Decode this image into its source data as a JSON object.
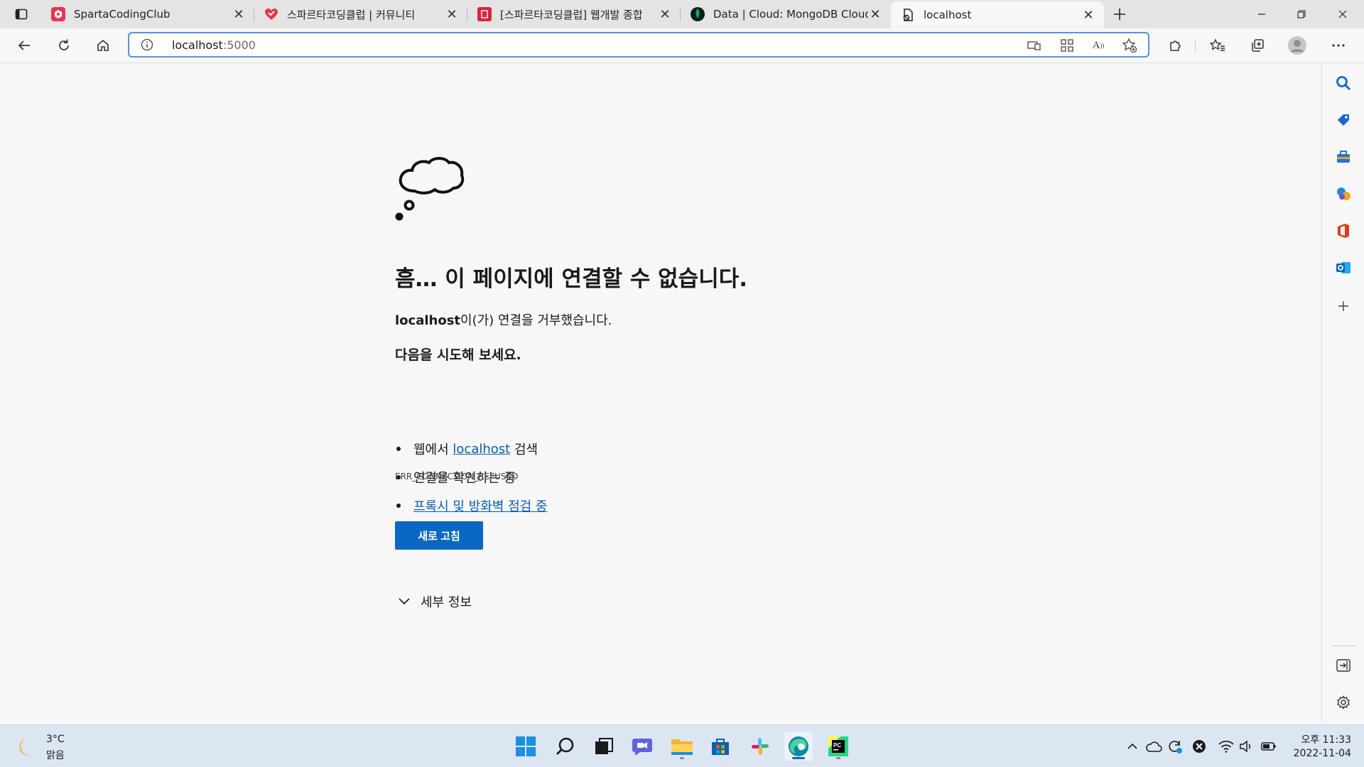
{
  "tabs": [
    {
      "title": "SpartaCodingClub",
      "favicon": "sparta-icon",
      "active": false
    },
    {
      "title": "스파르타코딩클럽 | 커뮤니티",
      "favicon": "heart-icon",
      "active": false
    },
    {
      "title": "[스파르타코딩클럽] 웹개발 종합",
      "favicon": "book-icon",
      "active": false
    },
    {
      "title": "Data | Cloud: MongoDB Cloud",
      "favicon": "mongodb-leaf-icon",
      "active": false
    },
    {
      "title": "localhost",
      "favicon": "broken-page-icon",
      "active": true
    }
  ],
  "address": {
    "host": "localhost",
    "port": ":5000"
  },
  "error": {
    "title": "흠… 이 페이지에 연결할 수 없습니다.",
    "host": "localhost",
    "description": "이(가) 연결을 거부했습니다.",
    "try_title": "다음을 시도해 보세요.",
    "suggestions": [
      {
        "prefix": "웹에서 ",
        "link": "localhost",
        "suffix": " 검색"
      },
      {
        "text": "연결을 확인하는 중"
      },
      {
        "link": "프록시 및 방화벽 점검 중"
      }
    ],
    "code": "ERR_CONNECTION_REFUSED",
    "refresh_label": "새로 고침",
    "details_label": "세부 정보"
  },
  "taskbar": {
    "weather": {
      "temp": "3°C",
      "condition": "맑음"
    },
    "apps": [
      "windows-start-icon",
      "search-icon",
      "task-view-icon",
      "teams-chat-icon",
      "file-explorer-icon",
      "microsoft-store-icon",
      "slack-icon",
      "edge-icon",
      "pycharm-icon"
    ],
    "clock": {
      "time": "오후 11:33",
      "date": "2022-11-04"
    }
  },
  "colors": {
    "accent": "#0a67c2",
    "link": "#0b5cad",
    "taskbar": "#dce6f2"
  }
}
